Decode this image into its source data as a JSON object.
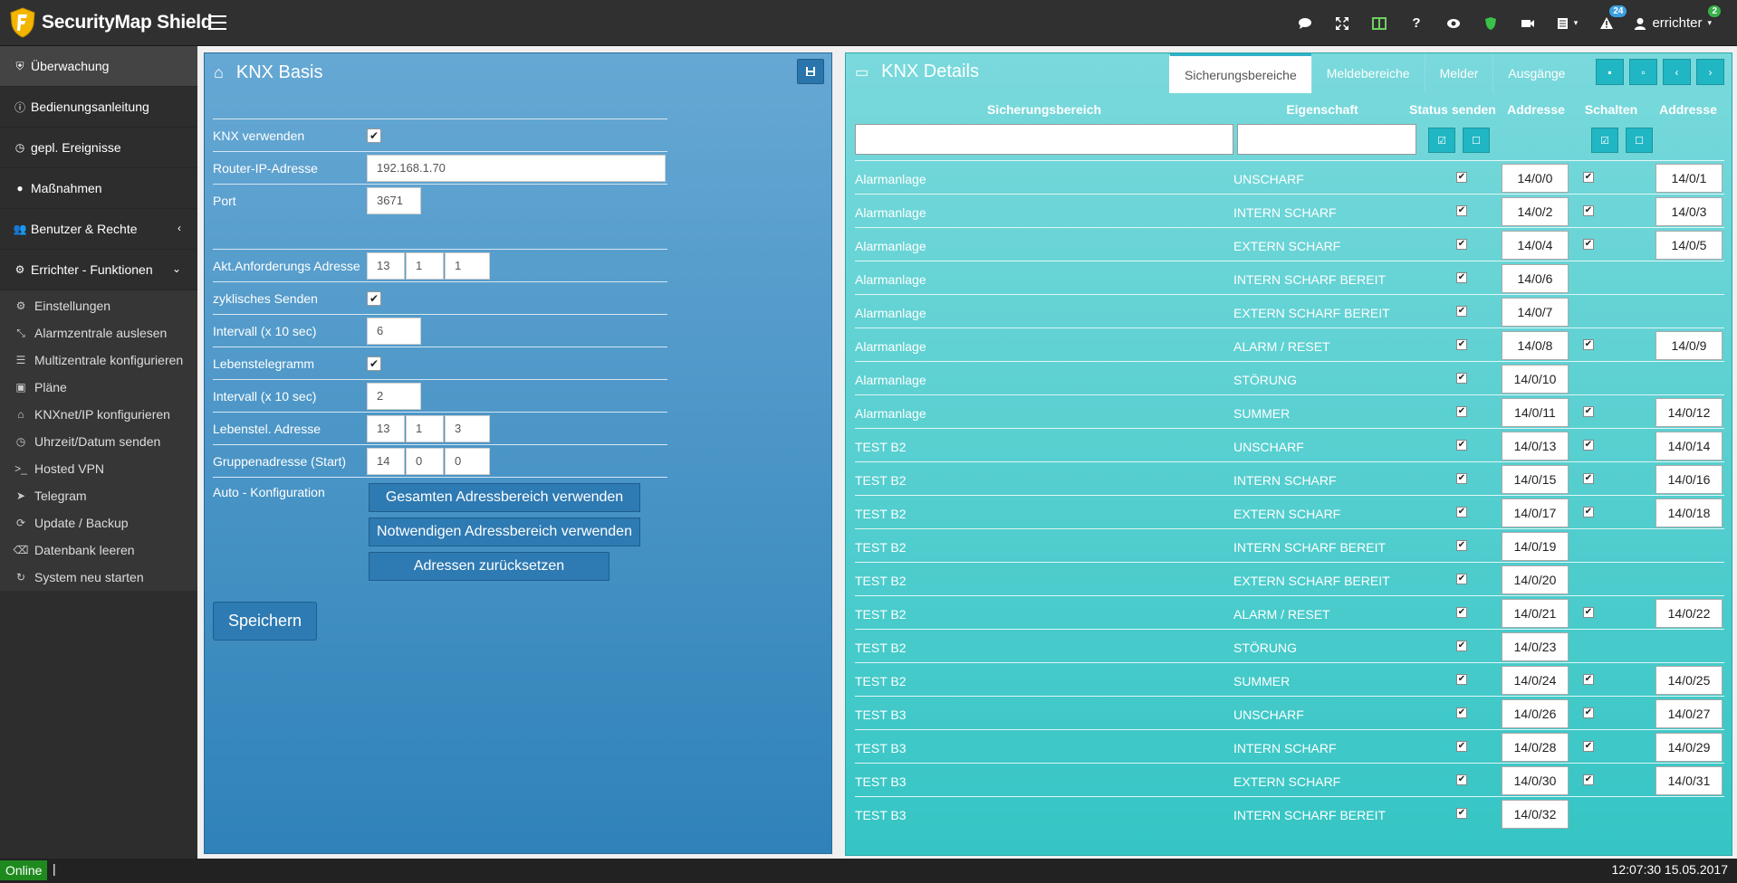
{
  "app": {
    "title": "SecurityMap Shield"
  },
  "header": {
    "badges": {
      "alerts": "24",
      "user": "2"
    },
    "user_name": "errichter"
  },
  "sidebar": {
    "main_items": [
      {
        "label": "Überwachung",
        "icon": "shield-icon"
      },
      {
        "label": "Bedienungsanleitung",
        "icon": "info-icon"
      },
      {
        "label": "gepl. Ereignisse",
        "icon": "clock-icon"
      },
      {
        "label": "Maßnahmen",
        "icon": "comment-icon"
      },
      {
        "label": "Benutzer & Rechte",
        "icon": "users-icon"
      },
      {
        "label": "Errichter - Funktionen",
        "icon": "cogs-icon"
      }
    ],
    "sub_items": [
      {
        "label": "Einstellungen",
        "icon": "cogs-icon"
      },
      {
        "label": "Alarmzentrale auslesen",
        "icon": "compress-icon"
      },
      {
        "label": "Multizentrale konfigurieren",
        "icon": "list-icon"
      },
      {
        "label": "Pläne",
        "icon": "map-icon"
      },
      {
        "label": "KNXnet/IP konfigurieren",
        "icon": "home-icon"
      },
      {
        "label": "Uhrzeit/Datum senden",
        "icon": "clock-icon"
      },
      {
        "label": "Hosted VPN",
        "icon": "terminal-icon"
      },
      {
        "label": "Telegram",
        "icon": "send-icon"
      },
      {
        "label": "Update / Backup",
        "icon": "refresh-icon"
      },
      {
        "label": "Datenbank leeren",
        "icon": "eraser-icon"
      },
      {
        "label": "System neu starten",
        "icon": "restart-icon"
      }
    ]
  },
  "knx_basis": {
    "title": "KNX Basis",
    "fields": {
      "knx_verwenden": {
        "label": "KNX verwenden",
        "checked": true
      },
      "router_ip": {
        "label": "Router-IP-Adresse",
        "value": "192.168.1.70"
      },
      "port": {
        "label": "Port",
        "value": "3671"
      },
      "akt_anf": {
        "label": "Akt.Anforderungs Adresse",
        "values": [
          "13",
          "1",
          "1"
        ]
      },
      "zyklisch": {
        "label": "zyklisches Senden",
        "checked": true
      },
      "intervall1": {
        "label": "Intervall (x 10 sec)",
        "value": "6"
      },
      "lebens": {
        "label": "Lebenstelegramm",
        "checked": true
      },
      "intervall2": {
        "label": "Intervall (x 10 sec)",
        "value": "2"
      },
      "lebens_addr": {
        "label": "Lebenstel. Adresse",
        "values": [
          "13",
          "1",
          "3"
        ]
      },
      "gruppe": {
        "label": "Gruppenadresse (Start)",
        "values": [
          "14",
          "0",
          "0"
        ]
      },
      "auto": {
        "label": "Auto - Konfiguration"
      }
    },
    "buttons": {
      "gesamt": "Gesamten Adressbereich verwenden",
      "notwendig": "Notwendigen Adressbereich verwenden",
      "reset": "Adressen zurücksetzen",
      "save": "Speichern"
    }
  },
  "knx_details": {
    "title": "KNX Details",
    "tabs": [
      "Sicherungsbereiche",
      "Meldebereiche",
      "Melder",
      "Ausgänge"
    ],
    "columns": [
      "Sicherungsbereich",
      "Eigenschaft",
      "Status senden",
      "Addresse",
      "Schalten",
      "Addresse"
    ],
    "rows": [
      {
        "bereich": "Alarmanlage",
        "eigenschaft": "UNSCHARF",
        "status": true,
        "addr1": "14/0/0",
        "schalten": true,
        "addr2": "14/0/1"
      },
      {
        "bereich": "Alarmanlage",
        "eigenschaft": "INTERN SCHARF",
        "status": true,
        "addr1": "14/0/2",
        "schalten": true,
        "addr2": "14/0/3"
      },
      {
        "bereich": "Alarmanlage",
        "eigenschaft": "EXTERN SCHARF",
        "status": true,
        "addr1": "14/0/4",
        "schalten": true,
        "addr2": "14/0/5"
      },
      {
        "bereich": "Alarmanlage",
        "eigenschaft": "INTERN SCHARF BEREIT",
        "status": true,
        "addr1": "14/0/6",
        "schalten": false,
        "addr2": ""
      },
      {
        "bereich": "Alarmanlage",
        "eigenschaft": "EXTERN SCHARF BEREIT",
        "status": true,
        "addr1": "14/0/7",
        "schalten": false,
        "addr2": ""
      },
      {
        "bereich": "Alarmanlage",
        "eigenschaft": "ALARM / RESET",
        "status": true,
        "addr1": "14/0/8",
        "schalten": true,
        "addr2": "14/0/9"
      },
      {
        "bereich": "Alarmanlage",
        "eigenschaft": "STÖRUNG",
        "status": true,
        "addr1": "14/0/10",
        "schalten": false,
        "addr2": ""
      },
      {
        "bereich": "Alarmanlage",
        "eigenschaft": "SUMMER",
        "status": true,
        "addr1": "14/0/11",
        "schalten": true,
        "addr2": "14/0/12"
      },
      {
        "bereich": "TEST B2",
        "eigenschaft": "UNSCHARF",
        "status": true,
        "addr1": "14/0/13",
        "schalten": true,
        "addr2": "14/0/14"
      },
      {
        "bereich": "TEST B2",
        "eigenschaft": "INTERN SCHARF",
        "status": true,
        "addr1": "14/0/15",
        "schalten": true,
        "addr2": "14/0/16"
      },
      {
        "bereich": "TEST B2",
        "eigenschaft": "EXTERN SCHARF",
        "status": true,
        "addr1": "14/0/17",
        "schalten": true,
        "addr2": "14/0/18"
      },
      {
        "bereich": "TEST B2",
        "eigenschaft": "INTERN SCHARF BEREIT",
        "status": true,
        "addr1": "14/0/19",
        "schalten": false,
        "addr2": ""
      },
      {
        "bereich": "TEST B2",
        "eigenschaft": "EXTERN SCHARF BEREIT",
        "status": true,
        "addr1": "14/0/20",
        "schalten": false,
        "addr2": ""
      },
      {
        "bereich": "TEST B2",
        "eigenschaft": "ALARM / RESET",
        "status": true,
        "addr1": "14/0/21",
        "schalten": true,
        "addr2": "14/0/22"
      },
      {
        "bereich": "TEST B2",
        "eigenschaft": "STÖRUNG",
        "status": true,
        "addr1": "14/0/23",
        "schalten": false,
        "addr2": ""
      },
      {
        "bereich": "TEST B2",
        "eigenschaft": "SUMMER",
        "status": true,
        "addr1": "14/0/24",
        "schalten": true,
        "addr2": "14/0/25"
      },
      {
        "bereich": "TEST B3",
        "eigenschaft": "UNSCHARF",
        "status": true,
        "addr1": "14/0/26",
        "schalten": true,
        "addr2": "14/0/27"
      },
      {
        "bereich": "TEST B3",
        "eigenschaft": "INTERN SCHARF",
        "status": true,
        "addr1": "14/0/28",
        "schalten": true,
        "addr2": "14/0/29"
      },
      {
        "bereich": "TEST B3",
        "eigenschaft": "EXTERN SCHARF",
        "status": true,
        "addr1": "14/0/30",
        "schalten": true,
        "addr2": "14/0/31"
      },
      {
        "bereich": "TEST B3",
        "eigenschaft": "INTERN SCHARF BEREIT",
        "status": true,
        "addr1": "14/0/32",
        "schalten": false,
        "addr2": ""
      }
    ]
  },
  "status": {
    "online": "Online",
    "cursor": "|",
    "datetime": "12:07:30 15.05.2017"
  }
}
